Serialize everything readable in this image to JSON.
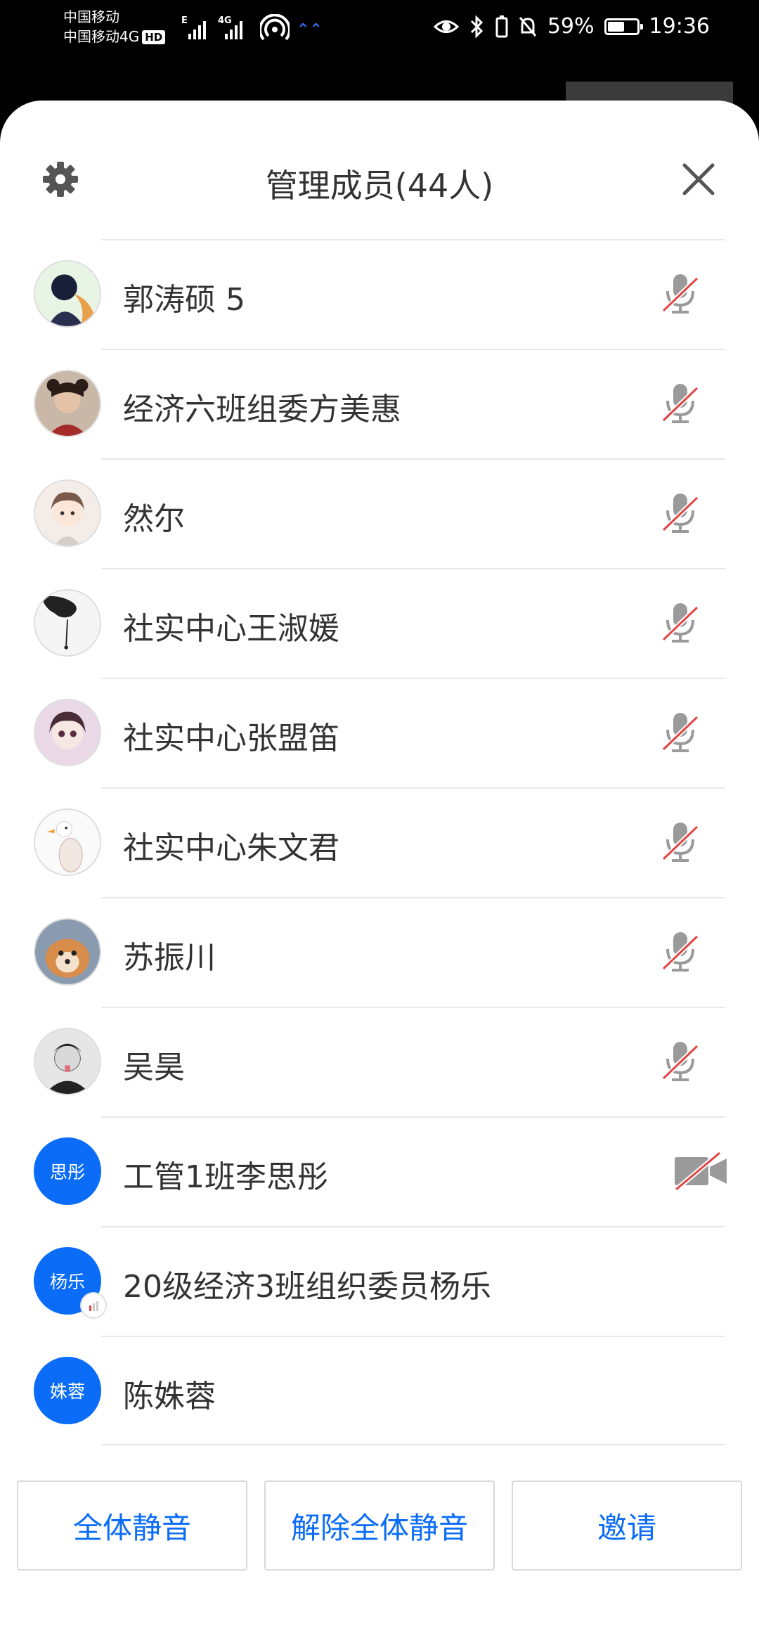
{
  "status_bar": {
    "carrier1": "中国移动",
    "carrier2": "中国移动4G",
    "hd": "HD",
    "signal_label_1": "E",
    "signal_label_2": "4G",
    "battery_percent": "59%",
    "battery_level": 0.59,
    "time": "19:36"
  },
  "header": {
    "title": "管理成员(44人)"
  },
  "members": [
    {
      "name": "郭涛硕 5",
      "avatar": "photo",
      "status": "mic-muted"
    },
    {
      "name": "经济六班组委方美惠",
      "avatar": "photo",
      "status": "mic-muted"
    },
    {
      "name": "然尔",
      "avatar": "photo",
      "status": "mic-muted"
    },
    {
      "name": "社实中心王淑媛",
      "avatar": "photo",
      "status": "mic-muted"
    },
    {
      "name": "社实中心张盟笛",
      "avatar": "photo",
      "status": "mic-muted"
    },
    {
      "name": "社实中心朱文君",
      "avatar": "photo",
      "status": "mic-muted"
    },
    {
      "name": "苏振川",
      "avatar": "photo",
      "status": "mic-muted"
    },
    {
      "name": "吴昊",
      "avatar": "photo",
      "status": "mic-muted"
    },
    {
      "name": "工管1班李思彤",
      "avatar_text": "思彤",
      "status": "camera-off"
    },
    {
      "name": "20级经济3班组织委员杨乐",
      "avatar_text": "杨乐",
      "status": "speaking-badge"
    },
    {
      "name": "陈姝蓉",
      "avatar_text": "姝蓉",
      "status": "none"
    }
  ],
  "footer": {
    "mute_all": "全体静音",
    "unmute_all": "解除全体静音",
    "invite": "邀请"
  },
  "colors": {
    "accent": "#0a6cf7",
    "muted_slash": "#e14646",
    "icon_gray": "#9a9a9a"
  }
}
